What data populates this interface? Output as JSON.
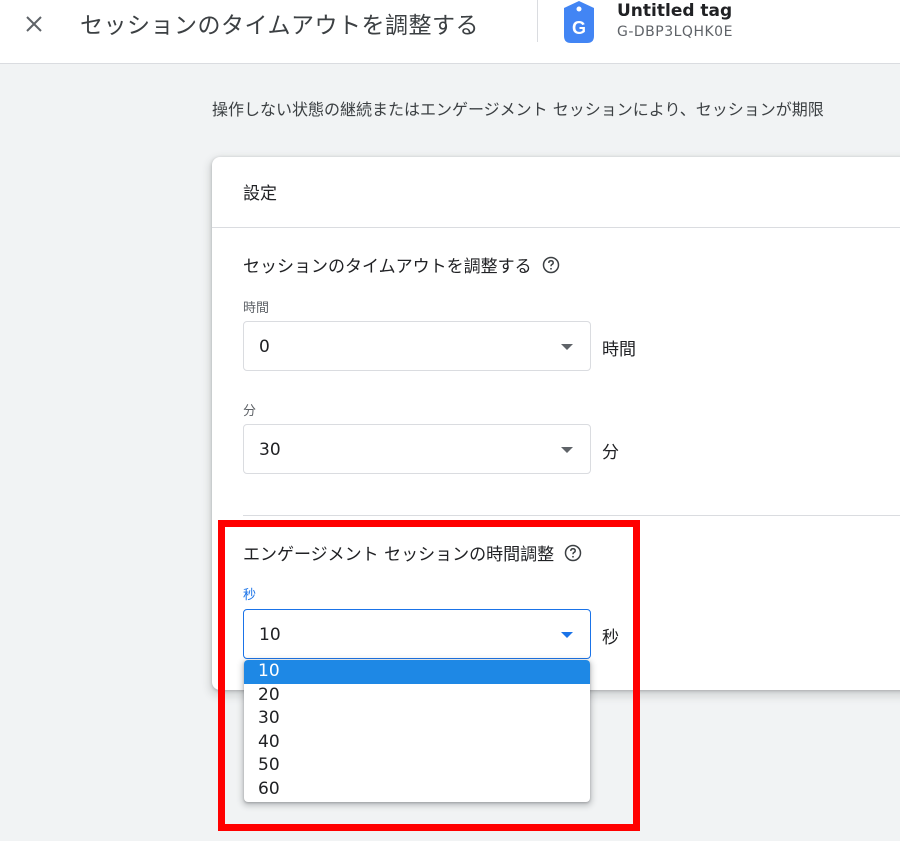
{
  "header": {
    "title": "セッションのタイムアウトを調整する",
    "tag_name": "Untitled tag",
    "tag_id": "G-DBP3LQHK0E",
    "tag_letter": "G"
  },
  "description": "操作しない状態の継続またはエンゲージメント セッションにより、セッションが期限",
  "card": {
    "title": "設定",
    "timeout_section": {
      "title": "セッションのタイムアウトを調整する",
      "hours": {
        "label": "時間",
        "value": "0",
        "unit": "時間"
      },
      "minutes": {
        "label": "分",
        "value": "30",
        "unit": "分"
      }
    },
    "engaged_section": {
      "title": "エンゲージメント セッションの時間調整",
      "seconds": {
        "label": "秒",
        "value": "10",
        "unit": "秒"
      }
    }
  },
  "dropdown": {
    "options": [
      "10",
      "20",
      "30",
      "40",
      "50",
      "60"
    ],
    "selected": "10"
  },
  "colors": {
    "accent": "#1a73e8",
    "selected_option": "#1e88e5",
    "highlight": "#ff0000",
    "tag_badge": "#4285f4"
  },
  "icons": {
    "close": "close-icon",
    "tag": "tag-icon",
    "help": "help-icon",
    "dropdown": "dropdown-arrow-icon"
  }
}
